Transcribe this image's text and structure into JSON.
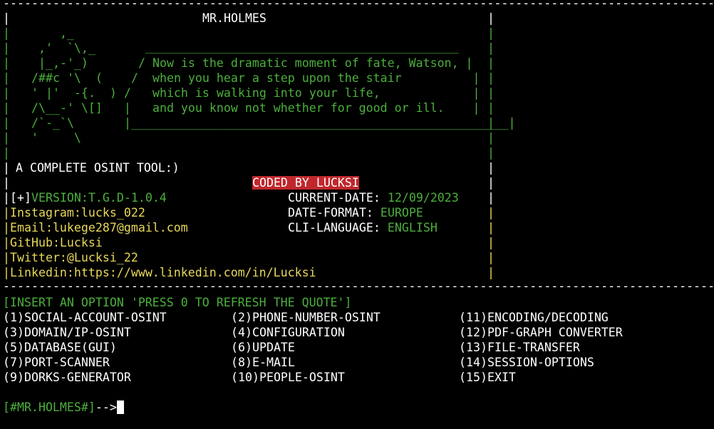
{
  "colors": {
    "background": "#000000",
    "text": "#ffffff",
    "green": "#4caf3c",
    "yellow": "#e8d85a",
    "highlight": "#c0272d"
  },
  "banner": {
    "rule": "-----------------------------------------------------------------------------------------------------",
    "title": "MR.HOLMES",
    "art": [
      "    ,_",
      "  ,'  `\\,_",
      "  |_,-'_)",
      " /##c '\\  (",
      " ' |'  -{.  ) /",
      " /\\__-' \\[]   |",
      " /`-_`\\",
      " '     \\"
    ],
    "quote_top": "____________________________________________",
    "quote_lines": [
      "/ Now is the dramatic moment of fate, Watson, |",
      "/  when you hear a step upon the stair          |",
      "    which is walking into your life,             |",
      "    and you know not whether for good or ill.    |"
    ],
    "quote_bottom": "|_____________________________________________________|",
    "tagline": " A COMPLETE OSINT TOOL:)",
    "coded_by": "CODED BY LUCKSI"
  },
  "info": {
    "version_prefix": "[+]",
    "version": "VERSION:T.G.D-1.0.4",
    "instagram": "Instagram:lucks_022",
    "email": "Email:lukege287@gmail.com",
    "github": "GitHub:Lucksi",
    "twitter": "Twitter:@Lucksi_22",
    "linkedin": "Linkedin:https://www.linkedin.com/in/Lucksi",
    "current_date_label": "CURRENT-DATE: ",
    "current_date": "12/09/2023",
    "date_format_label": "DATE-FORMAT: ",
    "date_format": "EUROPE",
    "cli_language_label": "CLI-LANGUAGE: ",
    "cli_language": "ENGLISH"
  },
  "menu": {
    "prompt": "[INSERT AN OPTION 'PRESS 0 TO REFRESH THE QUOTE']",
    "options": [
      "(1)SOCIAL-ACCOUNT-OSINT",
      "(2)PHONE-NUMBER-OSINT",
      "(11)ENCODING/DECODING",
      "(3)DOMAIN/IP-OSINT",
      "(4)CONFIGURATION",
      "(12)PDF-GRAPH CONVERTER",
      "(5)DATABASE(GUI)",
      "(6)UPDATE",
      "(13)FILE-TRANSFER",
      "(7)PORT-SCANNER",
      "(8)E-MAIL",
      "(14)SESSION-OPTIONS",
      "(9)DORKS-GENERATOR",
      "(10)PEOPLE-OSINT",
      "(15)EXIT"
    ]
  },
  "shell": {
    "prompt": "[#MR.HOLMES#]",
    "arrow": "-->"
  }
}
